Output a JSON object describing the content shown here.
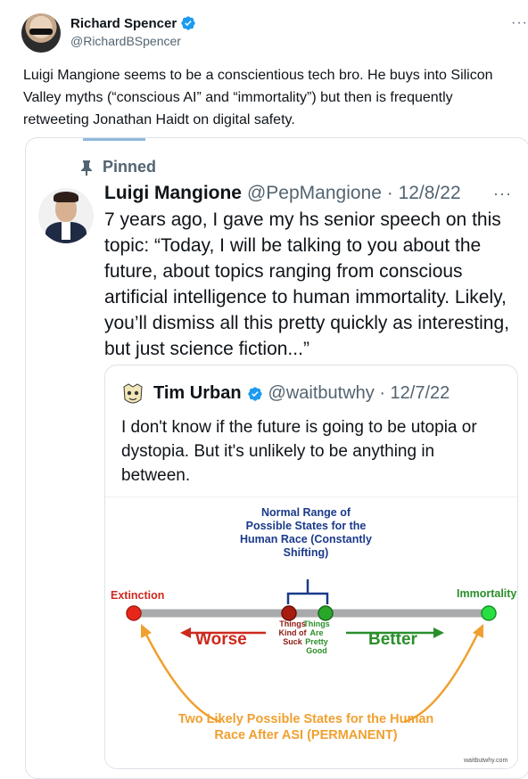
{
  "author": {
    "name": "Richard Spencer",
    "handle": "@RichardBSpencer",
    "verified": true,
    "avatar_icon": "profile-photo-sunglasses"
  },
  "tweet": {
    "text": "Luigi Mangione seems to be a conscientious tech bro. He buys into Silicon Valley myths (“conscious AI” and “immortality”) but then is frequently retweeting Jonathan Haidt on digital safety.",
    "more_icon": "more-icon"
  },
  "embedded": {
    "pinned_label": "Pinned",
    "author_name": "Luigi Mangione",
    "author_meta": "@PepMangione · 12/8/22",
    "text": "7 years ago, I gave my hs senior speech on this topic: “Today, I will be talking to you about the future, about topics ranging from conscious artificial intelligence to human immortality. Likely, you’ll dismiss all this pretty quickly as interesting, but just science fiction...”",
    "quote": {
      "author_name": "Tim Urban",
      "author_meta": "@waitbutwhy · 12/7/22",
      "verified": true,
      "text": "I don't know if the future is going to be utopia or dystopia. But it's unlikely to be anything in between.",
      "figure": {
        "title": "Normal Range of Possible States for the Human Race (Constantly Shifting)",
        "extinction": "Extinction",
        "immortality": "Immortality",
        "things_suck": "Things Kind of Suck",
        "things_good": "Things Are Pretty Good",
        "worse": "Worse",
        "better": "Better",
        "bottom": "Two Likely Possible States for the Human Race After ASI (PERMANENT)",
        "watermark": "waitbutwhy.com",
        "colors": {
          "extinction": "#e8271b",
          "immortality": "#28c840",
          "suck": "#a81c10",
          "good": "#2aa72a",
          "title": "#1a3a8a",
          "arrows": "#f0a030"
        }
      }
    }
  },
  "colors": {
    "verified": "#1d9bf0",
    "secondary_text": "#536471"
  }
}
